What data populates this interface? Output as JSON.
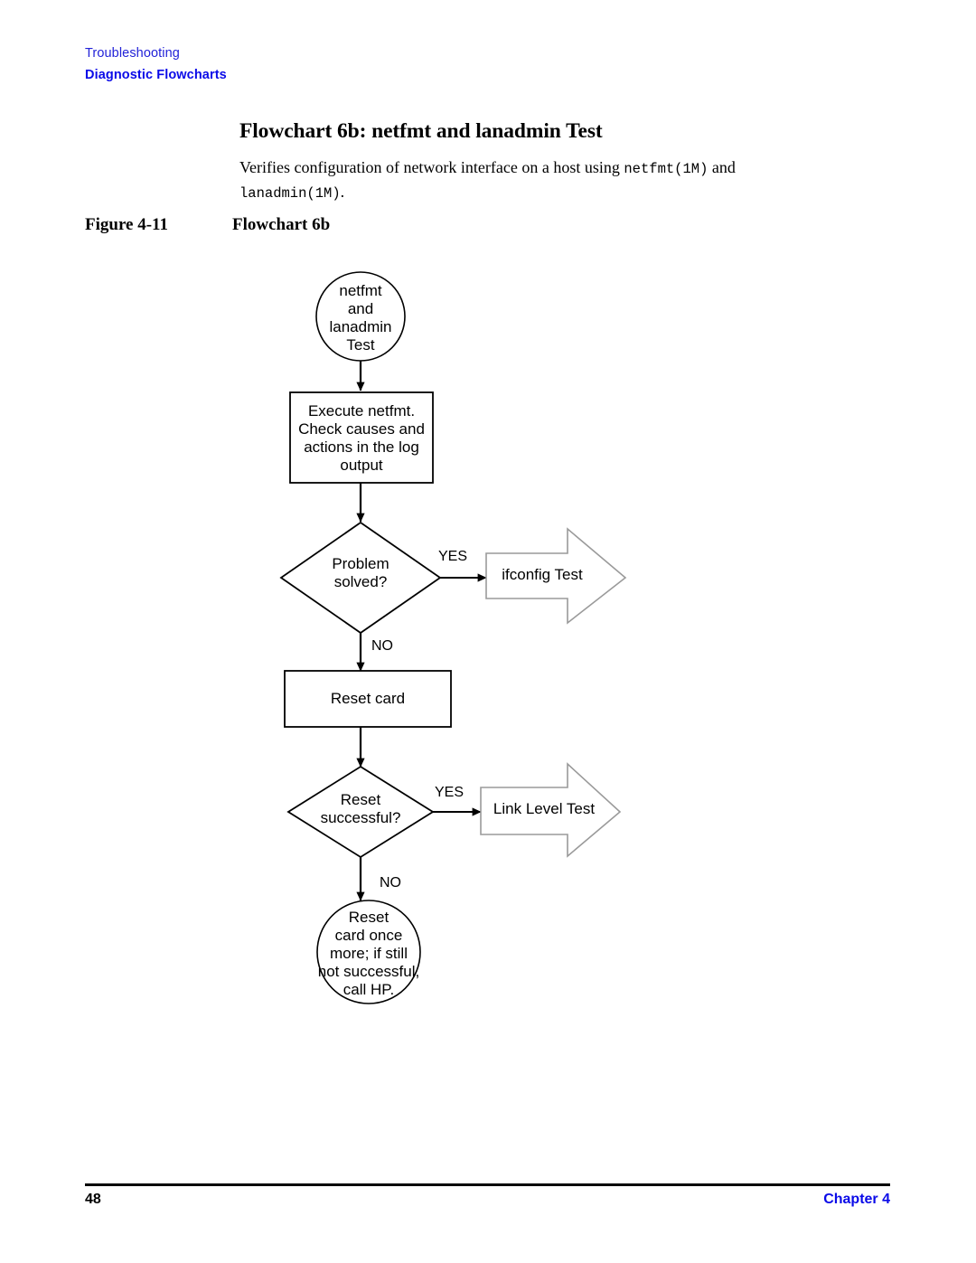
{
  "header": {
    "chapter_title": "Troubleshooting",
    "section_title": "Diagnostic Flowcharts",
    "link_color": "#0a0ae8"
  },
  "title": "Flowchart 6b: netfmt and lanadmin Test",
  "intro": {
    "part1": "Verifies configuration of network interface on a host using ",
    "mono1": "netfmt(1M)",
    "part2": " and ",
    "mono2": "lanadmin(1M)",
    "part3": "."
  },
  "figure": {
    "number": "Figure 4-11",
    "caption": "Flowchart 6b"
  },
  "flowchart": {
    "nodes": [
      {
        "id": "start",
        "shape": "circle",
        "text": "netfmt\nand\nlanadmin\nTest"
      },
      {
        "id": "execute",
        "shape": "rectangle",
        "text": "Execute netfmt.\nCheck causes and\nactions in the log\noutput"
      },
      {
        "id": "problem",
        "shape": "diamond",
        "text": "Problem\nsolved?"
      },
      {
        "id": "ifconfig",
        "shape": "block-arrow",
        "text": "ifconfig Test"
      },
      {
        "id": "resetcard",
        "shape": "rectangle",
        "text": "Reset card"
      },
      {
        "id": "resetok",
        "shape": "diamond",
        "text": "Reset\nsuccessful?"
      },
      {
        "id": "linklevel",
        "shape": "block-arrow",
        "text": "Link Level Test"
      },
      {
        "id": "callhp",
        "shape": "circle",
        "text": "Reset\ncard once\nmore; if still\nnot successful,\ncall HP."
      }
    ],
    "edge_labels": {
      "problem_yes": "YES",
      "problem_no": "NO",
      "resetok_yes": "YES",
      "resetok_no": "NO"
    },
    "colors": {
      "stroke": "#000000",
      "arrow_block_stroke": "#9a9a9a",
      "fill": "#ffffff"
    }
  },
  "footer": {
    "page_number": "48",
    "chapter_label": "Chapter 4"
  }
}
